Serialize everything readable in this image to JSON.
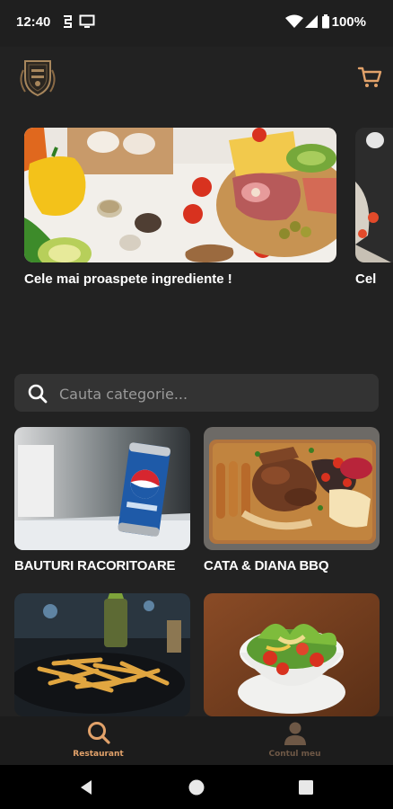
{
  "status_bar": {
    "time": "12:40",
    "battery": "100%"
  },
  "header": {
    "logo_icon": "restaurant-crest-logo",
    "cart_icon": "shopping-cart-icon"
  },
  "carousel": {
    "slides": [
      {
        "caption": "Cele mai proaspete ingrediente !"
      },
      {
        "caption": "Cel"
      }
    ]
  },
  "search": {
    "placeholder": "Cauta categorie..."
  },
  "categories": [
    {
      "label": "BAUTURI RACORITOARE"
    },
    {
      "label": "CATA & DIANA BBQ"
    },
    {
      "label": ""
    },
    {
      "label": ""
    }
  ],
  "bottom_nav": {
    "items": [
      {
        "label": "Restaurant",
        "icon": "search-icon",
        "active": true
      },
      {
        "label": "Contul meu",
        "icon": "user-icon",
        "active": false
      }
    ]
  },
  "colors": {
    "accent": "#e2a26a",
    "background": "#222222",
    "surface": "#333333"
  }
}
